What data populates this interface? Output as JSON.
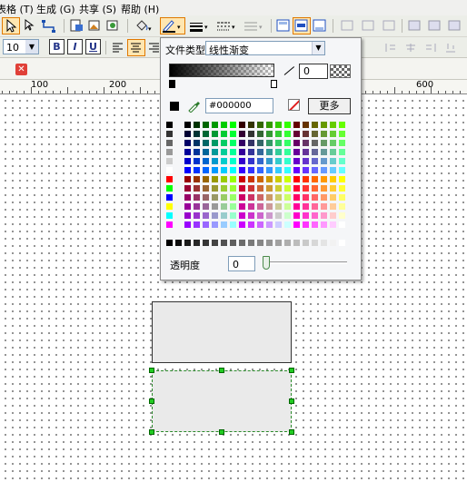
{
  "menu": [
    "表格 (T)",
    "生成 (G)",
    "共享 (S)",
    "帮助 (H)"
  ],
  "toolbar": {
    "font_size": "10",
    "bold": "B",
    "italic": "I",
    "underline": "U"
  },
  "ruler": {
    "labels": [
      "100",
      "200",
      "600"
    ]
  },
  "popup": {
    "file_type_label": "文件类型",
    "file_type_value": "线性渐变",
    "angle_value": "0",
    "hex_value": "#000000",
    "more_button": "更多",
    "transparency_label": "透明度",
    "transparency_value": "0"
  },
  "colors": {
    "selected_color": "#000000",
    "highlight_border": "#e07800",
    "selection_handle": "#22cc22"
  }
}
